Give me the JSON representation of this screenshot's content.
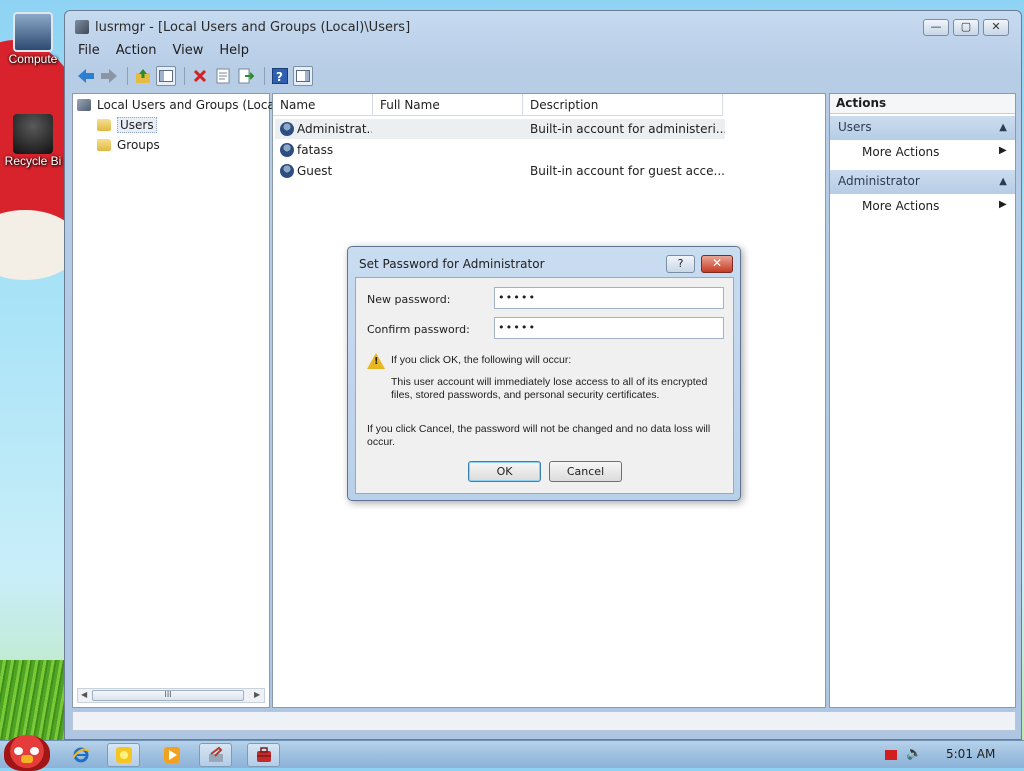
{
  "desktop": {
    "icons": [
      {
        "label": "Compute",
        "icon": "computer-icon"
      },
      {
        "label": "Recycle Bi",
        "icon": "recycle-bin-icon"
      }
    ]
  },
  "window": {
    "title": "lusrmgr - [Local Users and Groups (Local)\\Users]",
    "controls": {
      "minimize": "—",
      "maximize": "▢",
      "close": "✕"
    },
    "menu": [
      "File",
      "Action",
      "View",
      "Help"
    ]
  },
  "toolbar": {
    "icons": [
      "back-arrow-icon",
      "forward-arrow-icon",
      "up-folder-icon",
      "show-hide-tree-icon",
      "delete-icon",
      "properties-icon",
      "export-list-icon",
      "help-icon",
      "show-hide-action-pane-icon"
    ]
  },
  "tree": {
    "root": "Local Users and Groups (Loca",
    "items": [
      "Users",
      "Groups"
    ],
    "scrollbar_grip": "III"
  },
  "list": {
    "columns": [
      "Name",
      "Full Name",
      "Description"
    ],
    "rows": [
      {
        "name": "Administrat...",
        "full_name": "",
        "description": "Built-in account for administeri..."
      },
      {
        "name": "fatass",
        "full_name": "",
        "description": ""
      },
      {
        "name": "Guest",
        "full_name": "",
        "description": "Built-in account for guest acce..."
      }
    ]
  },
  "actions": {
    "title": "Actions",
    "sections": [
      {
        "header": "Users",
        "link": "More Actions"
      },
      {
        "header": "Administrator",
        "link": "More Actions"
      }
    ]
  },
  "dialog": {
    "title": "Set Password for Administrator",
    "help_label": "?",
    "close_label": "✕",
    "new_password_label": "New password:",
    "new_password_value": "•••••",
    "confirm_password_label": "Confirm password:",
    "confirm_password_value": "•••••",
    "warning_heading": "If you click OK, the following will occur:",
    "warning_body": "This user account will immediately lose access to all of its encrypted files, stored passwords, and personal security certificates.",
    "cancel_note": "If you click Cancel, the password will not be changed and no data loss will occur.",
    "ok_label": "OK",
    "cancel_label": "Cancel"
  },
  "taskbar": {
    "clock": "5:01 AM",
    "buttons": [
      "internet-explorer-icon",
      "explorer-icon",
      "media-player-icon",
      "computer-management-icon",
      "toolbox-icon"
    ]
  },
  "colors": {
    "title_bar": "#b7cde6",
    "action_header": "#cbdcef",
    "close_button": "#c63b23",
    "taskbar": "#9ec0e0"
  }
}
